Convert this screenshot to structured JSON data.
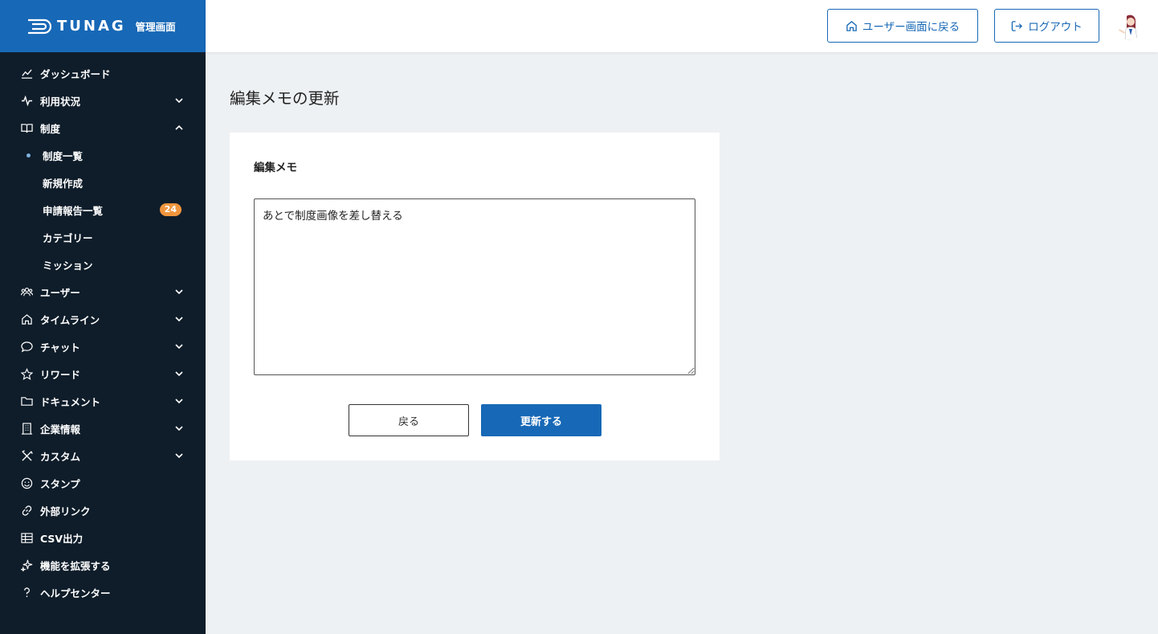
{
  "brand": {
    "name": "TUNAG",
    "subtitle": "管理画面"
  },
  "header": {
    "user_screen_button": "ユーザー画面に戻る",
    "logout_button": "ログアウト"
  },
  "sidebar": {
    "items": [
      {
        "label": "ダッシュボード",
        "icon": "chart-line-icon"
      },
      {
        "label": "利用状況",
        "icon": "activity-icon",
        "expandable": true
      },
      {
        "label": "制度",
        "icon": "book-icon",
        "expanded": true
      },
      {
        "label": "ユーザー",
        "icon": "users-icon",
        "expandable": true
      },
      {
        "label": "タイムライン",
        "icon": "home-icon",
        "expandable": true
      },
      {
        "label": "チャット",
        "icon": "chat-icon",
        "expandable": true
      },
      {
        "label": "リワード",
        "icon": "star-icon",
        "expandable": true
      },
      {
        "label": "ドキュメント",
        "icon": "folder-icon",
        "expandable": true
      },
      {
        "label": "企業情報",
        "icon": "building-icon",
        "expandable": true
      },
      {
        "label": "カスタム",
        "icon": "tools-icon",
        "expandable": true
      },
      {
        "label": "スタンプ",
        "icon": "smile-icon"
      },
      {
        "label": "外部リンク",
        "icon": "link-icon"
      },
      {
        "label": "CSV出力",
        "icon": "table-icon"
      },
      {
        "label": "機能を拡張する",
        "icon": "sparkle-icon"
      },
      {
        "label": "ヘルプセンター",
        "icon": "question-icon"
      }
    ],
    "sub_items": [
      {
        "label": "制度一覧",
        "active": true
      },
      {
        "label": "新規作成"
      },
      {
        "label": "申請報告一覧",
        "badge": "24"
      },
      {
        "label": "カテゴリー"
      },
      {
        "label": "ミッション"
      }
    ]
  },
  "main": {
    "title": "編集メモの更新",
    "field_label": "編集メモ",
    "memo_value": "あとで制度画像を差し替える",
    "back_button": "戻る",
    "update_button": "更新する"
  },
  "colors": {
    "brand": "#1768b6",
    "sidebar": "#0f1d2a",
    "badge": "#f0953d",
    "background": "#eef1f3"
  }
}
